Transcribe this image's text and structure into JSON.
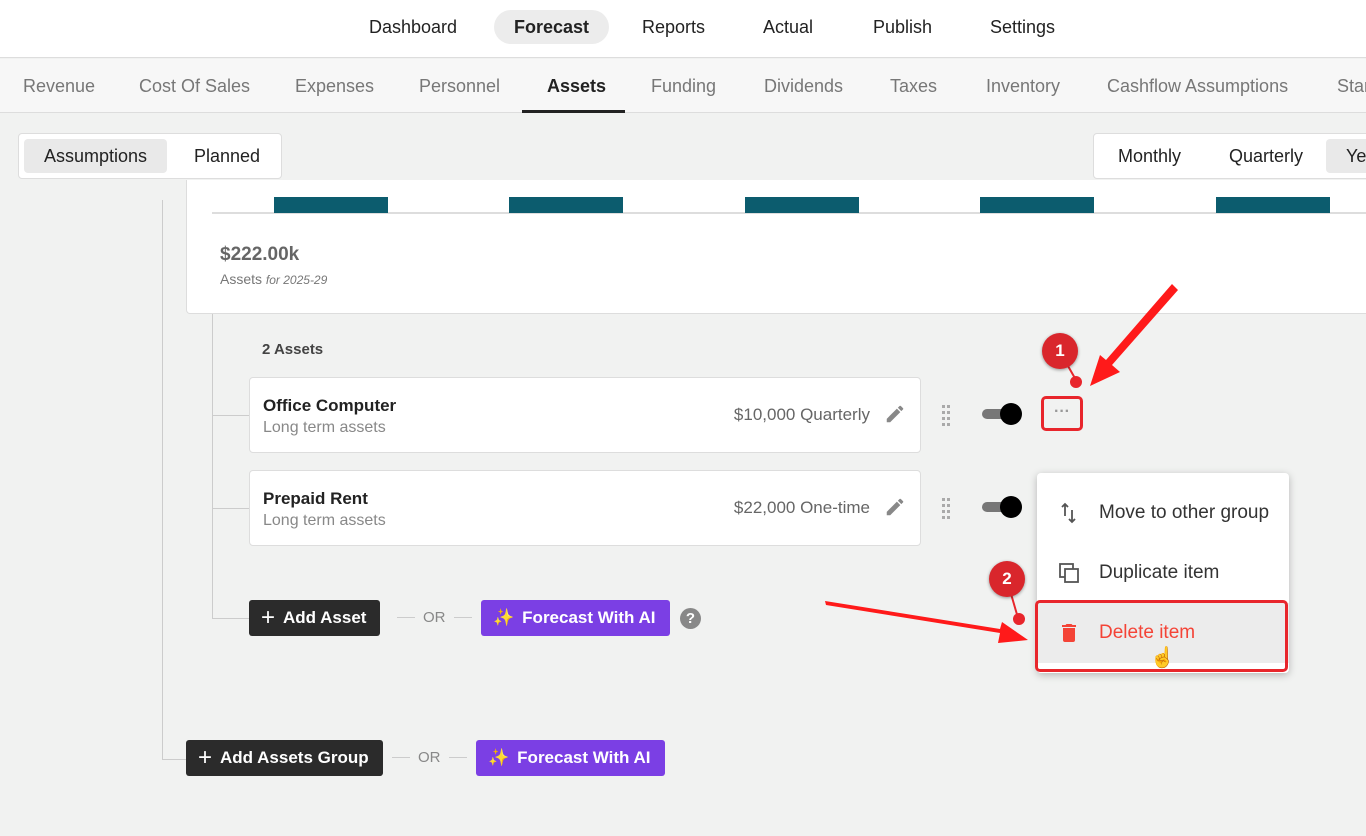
{
  "top_nav": {
    "items": [
      "Dashboard",
      "Forecast",
      "Reports",
      "Actual",
      "Publish",
      "Settings"
    ],
    "active": "Forecast"
  },
  "sub_nav": {
    "items": [
      "Revenue",
      "Cost Of Sales",
      "Expenses",
      "Personnel",
      "Assets",
      "Funding",
      "Dividends",
      "Taxes",
      "Inventory",
      "Cashflow Assumptions",
      "Star"
    ],
    "active": "Assets"
  },
  "view_toggle": {
    "items": [
      "Assumptions",
      "Planned"
    ],
    "active": "Assumptions"
  },
  "period_toggle": {
    "items": [
      "Monthly",
      "Quarterly",
      "Ye"
    ],
    "active": "Ye"
  },
  "summary": {
    "total": "$222.00k",
    "label": "Assets",
    "period": "for 2025-29",
    "bar_color": "#0c5c6e"
  },
  "group": {
    "count_label": "2 Assets",
    "items": [
      {
        "name": "Office Computer",
        "category": "Long term assets",
        "value": "$10,000 Quarterly",
        "enabled": true
      },
      {
        "name": "Prepaid Rent",
        "category": "Long term assets",
        "value": "$22,000 One-time",
        "enabled": true
      }
    ],
    "add_label": "Add Asset",
    "or": "OR",
    "ai_label": "Forecast With AI"
  },
  "footer": {
    "add_group_label": "Add Assets Group",
    "or": "OR",
    "ai_label": "Forecast With AI"
  },
  "context_menu": {
    "items": [
      {
        "label": "Move to other group",
        "icon": "swap-vertical-icon"
      },
      {
        "label": "Duplicate item",
        "icon": "duplicate-icon"
      },
      {
        "label": "Delete item",
        "icon": "trash-icon",
        "color": "#f44336"
      }
    ]
  },
  "annotations": {
    "step1": "1",
    "step2": "2",
    "color": "#e8262c"
  }
}
